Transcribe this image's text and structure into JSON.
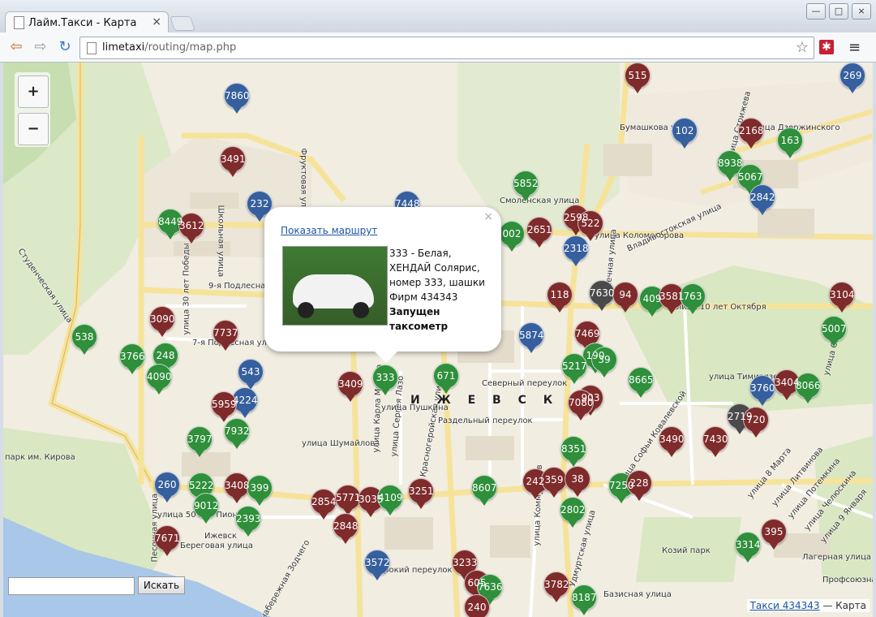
{
  "browser": {
    "tab_title": "Лайм.Такси - Карта",
    "tab_close": "×",
    "url_main": "limetaxi",
    "url_path": "/routing/map.php",
    "window_buttons": [
      "—",
      "□",
      "×"
    ]
  },
  "map": {
    "city_label": "И Ж Е В С К",
    "streets": [
      "Смоленская улица",
      "улица Коломогорова",
      "9-я Подлесная улица",
      "7-я Подлесная улица",
      "улица 10 лет Октября",
      "Северный переулок",
      "Раздельный переулок",
      "улица Шумайлова",
      "улица 50 лет Пионерии",
      "Береговая улица",
      "улица Карла Маркса",
      "улица Сергея Лазо",
      "Красногеройская улица",
      "улица Ленина",
      "Бумашкова улица",
      "улица Дзержинского",
      "Владивостокская улица",
      "Удмуртская улица",
      "Кузнечная улица",
      "Студенческая улица",
      "улица 30 лет Победы",
      "Школьная улица",
      "Фруктовая улица",
      "улица Коммунаров",
      "Советская улица",
      "улица Пушкина",
      "улица Тимирязева",
      "улица Серова",
      "улица Софьи Ковалевской",
      "улица 8 Марта",
      "улица Литвинова",
      "улица Потемкина",
      "улица Челюскина",
      "улица 9 Января",
      "Лагерная улица",
      "Профсоюзная улица",
      "Базисная улица",
      "Широкий переулок",
      "набережная Зодчего",
      "Ижевск",
      "Козий парк",
      "парк им. Кирова",
      "улица Стрижева",
      "Песочная улица"
    ],
    "markers": [
      {
        "label": "7860",
        "color": "blue"
      },
      {
        "label": "515",
        "color": "red"
      },
      {
        "label": "269",
        "color": "blue"
      },
      {
        "label": "102",
        "color": "blue"
      },
      {
        "label": "2168",
        "color": "red"
      },
      {
        "label": "163",
        "color": "green"
      },
      {
        "label": "8938",
        "color": "green"
      },
      {
        "label": "5067",
        "color": "green"
      },
      {
        "label": "2842",
        "color": "blue"
      },
      {
        "label": "3491",
        "color": "red"
      },
      {
        "label": "232",
        "color": "blue"
      },
      {
        "label": "7448",
        "color": "blue"
      },
      {
        "label": "5852",
        "color": "green"
      },
      {
        "label": "8449",
        "color": "green"
      },
      {
        "label": "3612",
        "color": "red"
      },
      {
        "label": "002",
        "color": "green"
      },
      {
        "label": "2651",
        "color": "red"
      },
      {
        "label": "2598",
        "color": "red"
      },
      {
        "label": "522",
        "color": "red"
      },
      {
        "label": "2318",
        "color": "blue"
      },
      {
        "label": "118",
        "color": "red"
      },
      {
        "label": "7630",
        "color": "gray"
      },
      {
        "label": "94",
        "color": "red"
      },
      {
        "label": "409",
        "color": "green"
      },
      {
        "label": "3581",
        "color": "red"
      },
      {
        "label": "763",
        "color": "green"
      },
      {
        "label": "3104",
        "color": "red"
      },
      {
        "label": "3090",
        "color": "red"
      },
      {
        "label": "7737",
        "color": "red"
      },
      {
        "label": "538",
        "color": "green"
      },
      {
        "label": "3766",
        "color": "green"
      },
      {
        "label": "248",
        "color": "green"
      },
      {
        "label": "4090",
        "color": "green"
      },
      {
        "label": "543",
        "color": "blue"
      },
      {
        "label": "3409",
        "color": "red"
      },
      {
        "label": "333",
        "color": "green"
      },
      {
        "label": "671",
        "color": "green"
      },
      {
        "label": "5874",
        "color": "blue"
      },
      {
        "label": "7469",
        "color": "red"
      },
      {
        "label": "190",
        "color": "green"
      },
      {
        "label": "39",
        "color": "green"
      },
      {
        "label": "5217",
        "color": "green"
      },
      {
        "label": "903",
        "color": "red"
      },
      {
        "label": "7080",
        "color": "red"
      },
      {
        "label": "8665",
        "color": "green"
      },
      {
        "label": "5007",
        "color": "green"
      },
      {
        "label": "3760",
        "color": "blue"
      },
      {
        "label": "3404",
        "color": "red"
      },
      {
        "label": "8066",
        "color": "green"
      },
      {
        "label": "2719",
        "color": "gray"
      },
      {
        "label": "720",
        "color": "red"
      },
      {
        "label": "4224",
        "color": "blue"
      },
      {
        "label": "5959",
        "color": "red"
      },
      {
        "label": "7932",
        "color": "green"
      },
      {
        "label": "3797",
        "color": "green"
      },
      {
        "label": "3490",
        "color": "red"
      },
      {
        "label": "7430",
        "color": "red"
      },
      {
        "label": "8351",
        "color": "green"
      },
      {
        "label": "260",
        "color": "blue"
      },
      {
        "label": "5222",
        "color": "green"
      },
      {
        "label": "3408",
        "color": "red"
      },
      {
        "label": "399",
        "color": "green"
      },
      {
        "label": "9012",
        "color": "green"
      },
      {
        "label": "2393",
        "color": "green"
      },
      {
        "label": "7671",
        "color": "red"
      },
      {
        "label": "2854",
        "color": "red"
      },
      {
        "label": "5771",
        "color": "red"
      },
      {
        "label": "3035",
        "color": "red"
      },
      {
        "label": "4109",
        "color": "green"
      },
      {
        "label": "3251",
        "color": "red"
      },
      {
        "label": "8607",
        "color": "green"
      },
      {
        "label": "242",
        "color": "red"
      },
      {
        "label": "359",
        "color": "red"
      },
      {
        "label": "38",
        "color": "red"
      },
      {
        "label": "7250",
        "color": "green"
      },
      {
        "label": "228",
        "color": "red"
      },
      {
        "label": "2802",
        "color": "green"
      },
      {
        "label": "2848",
        "color": "red"
      },
      {
        "label": "3572",
        "color": "blue"
      },
      {
        "label": "3233",
        "color": "red"
      },
      {
        "label": "605",
        "color": "red"
      },
      {
        "label": "7636",
        "color": "green"
      },
      {
        "label": "3782",
        "color": "red"
      },
      {
        "label": "8187",
        "color": "green"
      },
      {
        "label": "240",
        "color": "red"
      },
      {
        "label": "395",
        "color": "red"
      },
      {
        "label": "3314",
        "color": "green"
      }
    ]
  },
  "popup": {
    "route_link": "Показать маршрут",
    "close": "×",
    "line1": "333 - Белая,",
    "line2": "ХЕНДАЙ Солярис,",
    "line3": "номер 333, шашки",
    "line4": "Фирм 434343",
    "status": "Запущен таксометр"
  },
  "zoom": {
    "plus": "+",
    "minus": "−"
  },
  "search": {
    "value": "",
    "button": "Искать"
  },
  "footer": {
    "link": "Такси 434343",
    "suffix": " — Карта"
  }
}
